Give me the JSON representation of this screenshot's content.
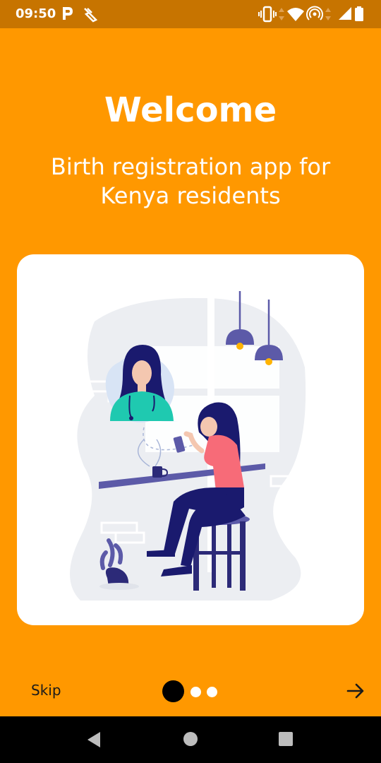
{
  "status_bar": {
    "time": "09:50",
    "left_icons": [
      "p-notification-icon",
      "cleaning-icon"
    ],
    "right_icons": [
      "vibrate-icon",
      "data-arrows-icon",
      "wifi-icon",
      "hotspot-icon",
      "signal-icon",
      "battery-icon"
    ]
  },
  "onboarding": {
    "title": "Welcome",
    "subtitle": "Birth registration app for Kenya residents",
    "illustration": "telehealth-consultation-illustration"
  },
  "footer": {
    "skip_label": "Skip",
    "page_count": 3,
    "active_page": 1,
    "next_icon": "arrow-right-icon"
  },
  "colors": {
    "background": "#ff9800",
    "status_bar": "#c77400",
    "accent_purple": "#5c5aa8",
    "navy": "#1a1a6e",
    "teal": "#1fc9b0",
    "pink": "#f76b78"
  },
  "nav_bar": {
    "icons": [
      "back-icon",
      "home-icon",
      "recents-icon"
    ]
  }
}
